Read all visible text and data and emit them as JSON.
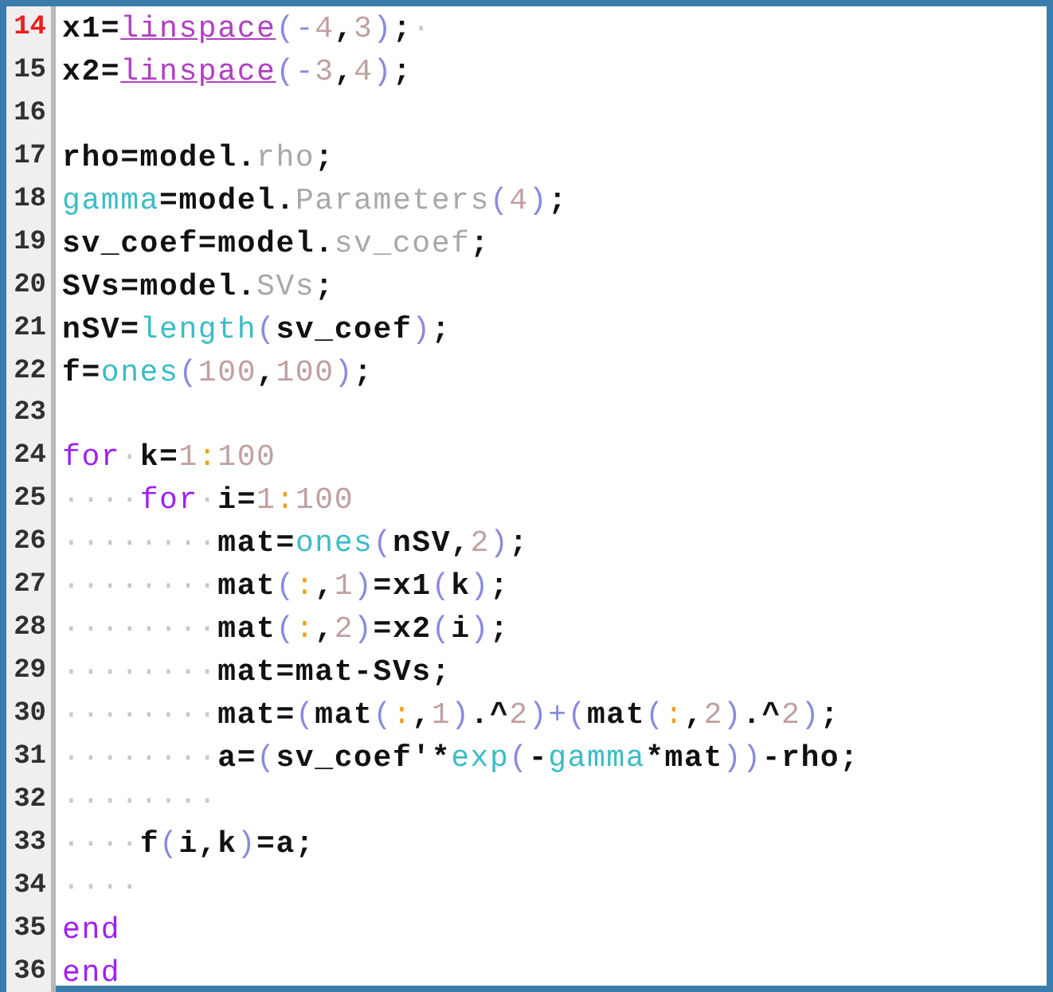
{
  "editor": {
    "lines": [
      {
        "number": "14",
        "current": true,
        "tokens": [
          {
            "kind": "plain",
            "text": "x1="
          },
          {
            "kind": "link",
            "text": "linspace"
          },
          {
            "kind": "paren",
            "text": "(-"
          },
          {
            "kind": "num",
            "text": "4"
          },
          {
            "kind": "plain",
            "text": ","
          },
          {
            "kind": "num",
            "text": "3"
          },
          {
            "kind": "paren",
            "text": ")"
          },
          {
            "kind": "plain",
            "text": ";"
          },
          {
            "kind": "space",
            "text": "·"
          }
        ]
      },
      {
        "number": "15",
        "current": false,
        "tokens": [
          {
            "kind": "plain",
            "text": "x2="
          },
          {
            "kind": "link",
            "text": "linspace"
          },
          {
            "kind": "paren",
            "text": "(-"
          },
          {
            "kind": "num",
            "text": "3"
          },
          {
            "kind": "plain",
            "text": ","
          },
          {
            "kind": "num",
            "text": "4"
          },
          {
            "kind": "paren",
            "text": ")"
          },
          {
            "kind": "plain",
            "text": ";"
          }
        ]
      },
      {
        "number": "16",
        "current": false
      },
      {
        "number": "17",
        "current": false,
        "tokens": [
          {
            "kind": "plain",
            "text": "rho=model."
          },
          {
            "kind": "member",
            "text": "rho"
          },
          {
            "kind": "plain",
            "text": ";"
          }
        ]
      },
      {
        "number": "18",
        "current": false,
        "tokens": [
          {
            "kind": "builtin",
            "text": "gamma"
          },
          {
            "kind": "plain",
            "text": "=model."
          },
          {
            "kind": "member",
            "text": "Parameters"
          },
          {
            "kind": "paren",
            "text": "("
          },
          {
            "kind": "num",
            "text": "4"
          },
          {
            "kind": "paren",
            "text": ")"
          },
          {
            "kind": "plain",
            "text": ";"
          }
        ]
      },
      {
        "number": "19",
        "current": false,
        "tokens": [
          {
            "kind": "plain",
            "text": "sv_coef=model."
          },
          {
            "kind": "member",
            "text": "sv_coef"
          },
          {
            "kind": "plain",
            "text": ";"
          }
        ]
      },
      {
        "number": "20",
        "current": false,
        "tokens": [
          {
            "kind": "plain",
            "text": "SVs=model."
          },
          {
            "kind": "member",
            "text": "SVs"
          },
          {
            "kind": "plain",
            "text": ";"
          }
        ]
      },
      {
        "number": "21",
        "current": false,
        "tokens": [
          {
            "kind": "plain",
            "text": "nSV="
          },
          {
            "kind": "builtin",
            "text": "length"
          },
          {
            "kind": "paren",
            "text": "("
          },
          {
            "kind": "plain",
            "text": "sv_coef"
          },
          {
            "kind": "paren",
            "text": ")"
          },
          {
            "kind": "plain",
            "text": ";"
          }
        ]
      },
      {
        "number": "22",
        "current": false,
        "tokens": [
          {
            "kind": "plain",
            "text": "f="
          },
          {
            "kind": "builtin",
            "text": "ones"
          },
          {
            "kind": "paren",
            "text": "("
          },
          {
            "kind": "num",
            "text": "100"
          },
          {
            "kind": "plain",
            "text": ","
          },
          {
            "kind": "num",
            "text": "100"
          },
          {
            "kind": "paren",
            "text": ")"
          },
          {
            "kind": "plain",
            "text": ";"
          }
        ]
      },
      {
        "number": "23",
        "current": false
      },
      {
        "number": "24",
        "current": false,
        "tokens": [
          {
            "kind": "keyword",
            "text": "for"
          },
          {
            "kind": "space",
            "text": "·"
          },
          {
            "kind": "plain",
            "text": "k="
          },
          {
            "kind": "num",
            "text": "1"
          },
          {
            "kind": "colon",
            "text": ":"
          },
          {
            "kind": "num",
            "text": "100"
          }
        ]
      },
      {
        "number": "25",
        "current": false,
        "tokens": [
          {
            "kind": "space",
            "text": "····"
          },
          {
            "kind": "keyword",
            "text": "for"
          },
          {
            "kind": "space",
            "text": "·"
          },
          {
            "kind": "plain",
            "text": "i="
          },
          {
            "kind": "num",
            "text": "1"
          },
          {
            "kind": "colon",
            "text": ":"
          },
          {
            "kind": "num",
            "text": "100"
          }
        ]
      },
      {
        "number": "26",
        "current": false,
        "tokens": [
          {
            "kind": "space",
            "text": "········"
          },
          {
            "kind": "plain",
            "text": "mat="
          },
          {
            "kind": "builtin",
            "text": "ones"
          },
          {
            "kind": "paren",
            "text": "("
          },
          {
            "kind": "plain",
            "text": "nSV,"
          },
          {
            "kind": "num",
            "text": "2"
          },
          {
            "kind": "paren",
            "text": ")"
          },
          {
            "kind": "plain",
            "text": ";"
          }
        ]
      },
      {
        "number": "27",
        "current": false,
        "tokens": [
          {
            "kind": "space",
            "text": "········"
          },
          {
            "kind": "plain",
            "text": "mat"
          },
          {
            "kind": "paren",
            "text": "("
          },
          {
            "kind": "colon",
            "text": ":"
          },
          {
            "kind": "plain",
            "text": ","
          },
          {
            "kind": "num",
            "text": "1"
          },
          {
            "kind": "paren",
            "text": ")"
          },
          {
            "kind": "plain",
            "text": "=x1"
          },
          {
            "kind": "paren",
            "text": "("
          },
          {
            "kind": "plain",
            "text": "k"
          },
          {
            "kind": "paren",
            "text": ")"
          },
          {
            "kind": "plain",
            "text": ";"
          }
        ]
      },
      {
        "number": "28",
        "current": false,
        "tokens": [
          {
            "kind": "space",
            "text": "········"
          },
          {
            "kind": "plain",
            "text": "mat"
          },
          {
            "kind": "paren",
            "text": "("
          },
          {
            "kind": "colon",
            "text": ":"
          },
          {
            "kind": "plain",
            "text": ","
          },
          {
            "kind": "num",
            "text": "2"
          },
          {
            "kind": "paren",
            "text": ")"
          },
          {
            "kind": "plain",
            "text": "=x2"
          },
          {
            "kind": "paren",
            "text": "("
          },
          {
            "kind": "plain",
            "text": "i"
          },
          {
            "kind": "paren",
            "text": ")"
          },
          {
            "kind": "plain",
            "text": ";"
          }
        ]
      },
      {
        "number": "29",
        "current": false,
        "tokens": [
          {
            "kind": "space",
            "text": "········"
          },
          {
            "kind": "plain",
            "text": "mat=mat-SVs;"
          }
        ]
      },
      {
        "number": "30",
        "current": false,
        "tokens": [
          {
            "kind": "space",
            "text": "········"
          },
          {
            "kind": "plain",
            "text": "mat="
          },
          {
            "kind": "paren",
            "text": "("
          },
          {
            "kind": "plain",
            "text": "mat"
          },
          {
            "kind": "paren",
            "text": "("
          },
          {
            "kind": "colon",
            "text": ":"
          },
          {
            "kind": "plain",
            "text": ","
          },
          {
            "kind": "num",
            "text": "1"
          },
          {
            "kind": "paren",
            "text": ")"
          },
          {
            "kind": "plain",
            "text": ".^"
          },
          {
            "kind": "num",
            "text": "2"
          },
          {
            "kind": "paren",
            "text": ")+("
          },
          {
            "kind": "plain",
            "text": "mat"
          },
          {
            "kind": "paren",
            "text": "("
          },
          {
            "kind": "colon",
            "text": ":"
          },
          {
            "kind": "plain",
            "text": ","
          },
          {
            "kind": "num",
            "text": "2"
          },
          {
            "kind": "paren",
            "text": ")"
          },
          {
            "kind": "plain",
            "text": ".^"
          },
          {
            "kind": "num",
            "text": "2"
          },
          {
            "kind": "paren",
            "text": ")"
          },
          {
            "kind": "plain",
            "text": ";"
          }
        ]
      },
      {
        "number": "31",
        "current": false,
        "tokens": [
          {
            "kind": "space",
            "text": "········"
          },
          {
            "kind": "plain",
            "text": "a="
          },
          {
            "kind": "paren",
            "text": "("
          },
          {
            "kind": "plain",
            "text": "sv_coef'*"
          },
          {
            "kind": "builtin",
            "text": "exp"
          },
          {
            "kind": "paren",
            "text": "("
          },
          {
            "kind": "plain",
            "text": "-"
          },
          {
            "kind": "builtin",
            "text": "gamma"
          },
          {
            "kind": "plain",
            "text": "*mat"
          },
          {
            "kind": "paren",
            "text": "))"
          },
          {
            "kind": "plain",
            "text": "-rho;"
          }
        ]
      },
      {
        "number": "32",
        "current": false,
        "tokens": [
          {
            "kind": "space",
            "text": "········"
          }
        ]
      },
      {
        "number": "33",
        "current": false,
        "tokens": [
          {
            "kind": "space",
            "text": "····"
          },
          {
            "kind": "plain",
            "text": "f"
          },
          {
            "kind": "paren",
            "text": "("
          },
          {
            "kind": "plain",
            "text": "i,k"
          },
          {
            "kind": "paren",
            "text": ")"
          },
          {
            "kind": "plain",
            "text": "=a;"
          }
        ]
      },
      {
        "number": "34",
        "current": false,
        "tokens": [
          {
            "kind": "space",
            "text": "····"
          }
        ]
      },
      {
        "number": "35",
        "current": false,
        "tokens": [
          {
            "kind": "keyword",
            "text": "end"
          }
        ]
      },
      {
        "number": "36",
        "current": false,
        "tokens": [
          {
            "kind": "keyword",
            "text": "end"
          }
        ]
      }
    ]
  }
}
